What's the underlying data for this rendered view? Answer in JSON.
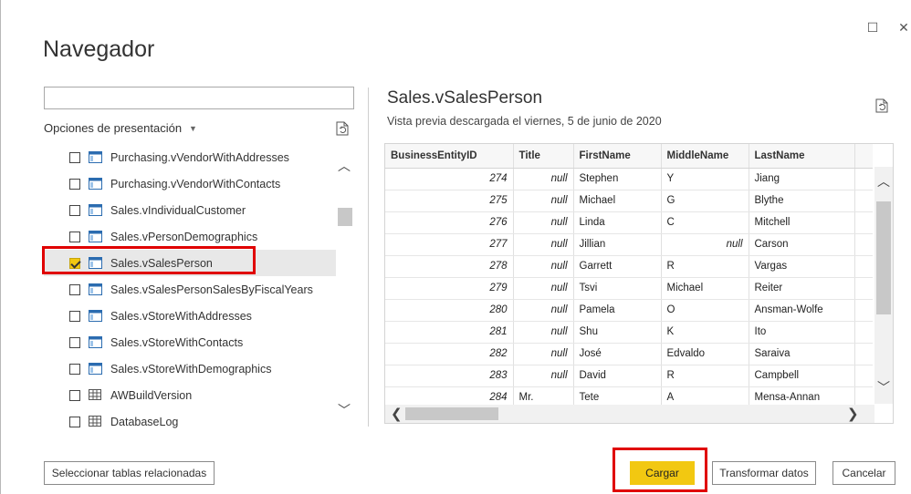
{
  "window": {
    "title": "Navegador",
    "maximize_glyph": "☐",
    "close_glyph": "✕"
  },
  "left_panel": {
    "search": {
      "value": "",
      "placeholder": ""
    },
    "display_options_label": "Opciones de presentación",
    "items": [
      {
        "label": "Purchasing.vVendorWithAddresses",
        "type": "view",
        "checked": false
      },
      {
        "label": "Purchasing.vVendorWithContacts",
        "type": "view",
        "checked": false
      },
      {
        "label": "Sales.vIndividualCustomer",
        "type": "view",
        "checked": false
      },
      {
        "label": "Sales.vPersonDemographics",
        "type": "view",
        "checked": false
      },
      {
        "label": "Sales.vSalesPerson",
        "type": "view",
        "checked": true
      },
      {
        "label": "Sales.vSalesPersonSalesByFiscalYears",
        "type": "view",
        "checked": false
      },
      {
        "label": "Sales.vStoreWithAddresses",
        "type": "view",
        "checked": false
      },
      {
        "label": "Sales.vStoreWithContacts",
        "type": "view",
        "checked": false
      },
      {
        "label": "Sales.vStoreWithDemographics",
        "type": "view",
        "checked": false
      },
      {
        "label": "AWBuildVersion",
        "type": "table",
        "checked": false
      },
      {
        "label": "DatabaseLog",
        "type": "table",
        "checked": false
      }
    ]
  },
  "preview": {
    "title": "Sales.vSalesPerson",
    "subtitle": "Vista previa descargada el viernes, 5 de junio de 2020",
    "columns": [
      "BusinessEntityID",
      "Title",
      "FirstName",
      "MiddleName",
      "LastName"
    ],
    "rows": [
      [
        "274",
        "null",
        "Stephen",
        "Y",
        "Jiang"
      ],
      [
        "275",
        "null",
        "Michael",
        "G",
        "Blythe"
      ],
      [
        "276",
        "null",
        "Linda",
        "C",
        "Mitchell"
      ],
      [
        "277",
        "null",
        "Jillian",
        "null",
        "Carson"
      ],
      [
        "278",
        "null",
        "Garrett",
        "R",
        "Vargas"
      ],
      [
        "279",
        "null",
        "Tsvi",
        "Michael",
        "Reiter"
      ],
      [
        "280",
        "null",
        "Pamela",
        "O",
        "Ansman-Wolfe"
      ],
      [
        "281",
        "null",
        "Shu",
        "K",
        "Ito"
      ],
      [
        "282",
        "null",
        "José",
        "Edvaldo",
        "Saraiva"
      ],
      [
        "283",
        "null",
        "David",
        "R",
        "Campbell"
      ],
      [
        "284",
        "Mr.",
        "Tete",
        "A",
        "Mensa-Annan"
      ]
    ]
  },
  "buttons": {
    "select_related": "Seleccionar tablas relacionadas",
    "load": "Cargar",
    "transform": "Transformar datos",
    "cancel": "Cancelar"
  },
  "colors": {
    "accent": "#f2c811",
    "highlight": "#e00000"
  }
}
